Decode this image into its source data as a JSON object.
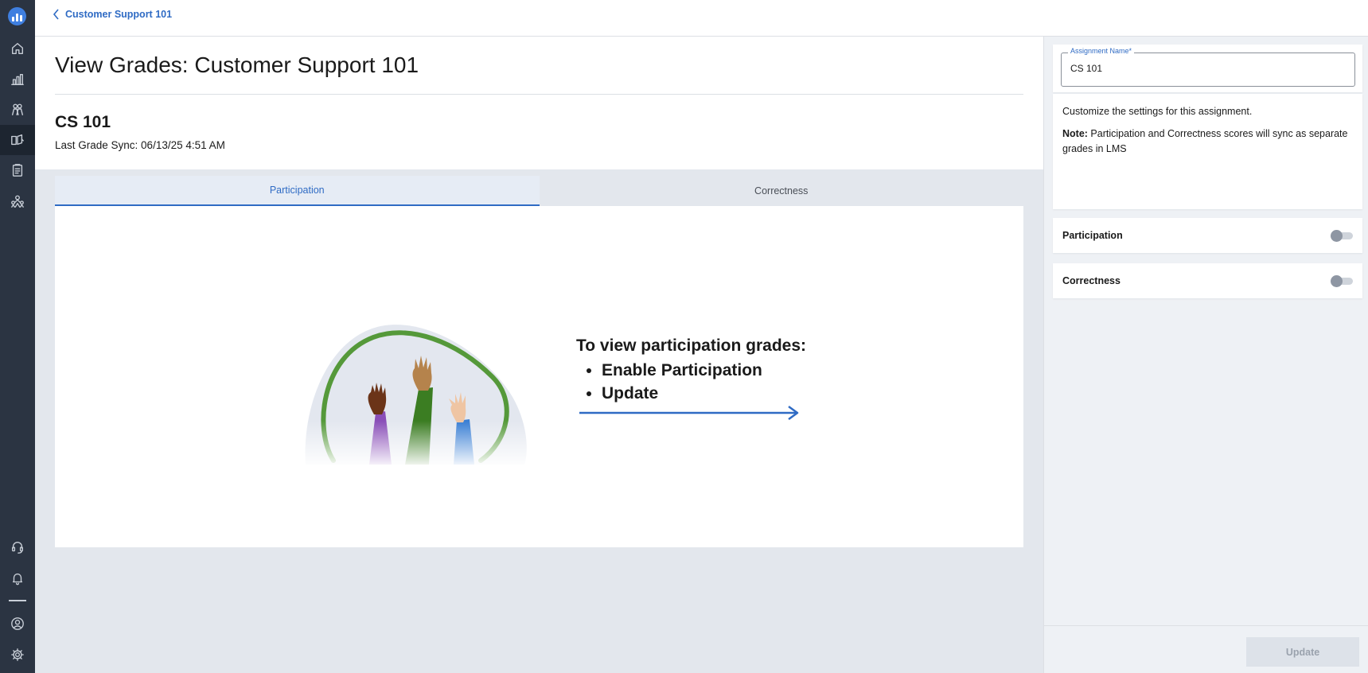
{
  "nav": {
    "items": [
      {
        "icon": "home-icon"
      },
      {
        "icon": "reports-chart-icon"
      },
      {
        "icon": "people-icon"
      },
      {
        "icon": "courses-book-icon",
        "active": true
      },
      {
        "icon": "clipboard-icon"
      },
      {
        "icon": "community-icon"
      },
      {
        "icon": "support-headset-icon"
      },
      {
        "icon": "bell-icon"
      },
      {
        "icon": "user-profile-icon"
      },
      {
        "icon": "settings-gear-icon"
      }
    ]
  },
  "breadcrumb": {
    "back_label": "Customer Support 101"
  },
  "page": {
    "title": "View Grades: Customer Support 101",
    "assignment_title": "CS 101",
    "last_sync": "Last Grade Sync: 06/13/25 4:51 AM"
  },
  "tabs": [
    {
      "label": "Participation",
      "active": true
    },
    {
      "label": "Correctness",
      "active": false
    }
  ],
  "empty_state": {
    "title": "To view participation grades:",
    "steps": [
      "Enable Participation",
      "Update"
    ]
  },
  "settings": {
    "assignment_name_label": "Assignment Name*",
    "assignment_name_value": "CS 101",
    "description": "Customize the settings for this assignment.",
    "note_label": "Note:",
    "note_text": " Participation and Correctness scores will sync as separate grades in LMS",
    "toggles": [
      {
        "label": "Participation",
        "enabled": false
      },
      {
        "label": "Correctness",
        "enabled": false
      }
    ],
    "update_label": "Update"
  },
  "colors": {
    "accent": "#2f6bc4",
    "nav_bg": "#2b3442",
    "panel_bg": "#eef1f5"
  }
}
